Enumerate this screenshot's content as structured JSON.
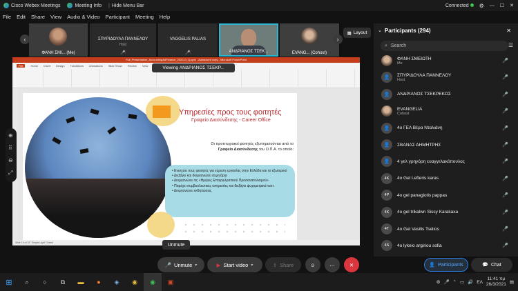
{
  "titlebar": {
    "app_title": "Cisco Webex Meetings",
    "info_tab": "Meeting Info",
    "hide_menu": "Hide Menu Bar",
    "connection": "Connected"
  },
  "menu": [
    "File",
    "Edit",
    "Share",
    "View",
    "Audio & Video",
    "Participant",
    "Meeting",
    "Help"
  ],
  "video_strip": {
    "tiles": [
      {
        "name": "ΦΑΝΗ ΣΜΙ... (Me)",
        "role": ""
      },
      {
        "name": "ΣΠΥΡΙΔΟΥΛΑ ΠΑΝΝΕΛΟΥ",
        "role": "Host"
      },
      {
        "name": "VAGGELIS PALIAS",
        "role": ""
      },
      {
        "name": "ΑΝΔΡΙΑΝΟΣ ΤΣΕΚ...",
        "role": ""
      },
      {
        "name": "EVANG... (Cohost)",
        "role": ""
      }
    ],
    "layout_label": "Layout"
  },
  "share": {
    "viewing_label": "Viewing ΑΝΔΡΙΑΝΟΣ ΤΣΕΚΡ...",
    "ppt_title": "Full_Presentation_AccountingAdFinance_2020-2 (1).pptx - Autosaved copy - Microsoft PowerPoint",
    "ppt_tabs": [
      "File",
      "Home",
      "Insert",
      "Design",
      "Transitions",
      "Animations",
      "Slide Show",
      "Review",
      "View"
    ],
    "status": "Slide 19 of 24    \"Simple Light\"    Greek",
    "slide": {
      "title": "Υπηρεσίες προς τους φοιτητές",
      "subtitle": "Γραφείο Διασύνδεσης - Career Office",
      "intro_line1": "Οι προπτυχιακοί φοιτητές εξυπηρετούνται από το",
      "intro_bold": "Γραφείο Διασύνδεσης",
      "intro_line2": "του Ο.Π.Α. το οποίο:",
      "bullets": [
        "Ενισχύει τους φοιτητές για εύρεση εργασίας στην Ελλάδα και το εξωτερικό",
        "Διεξάγει και διοργανώνει σεμινάρια",
        "Διοργανώνει τις «Ημέρες Επαγγελματικού Προσανατολισμού»",
        "Παρέχει συμβουλευτικές υπηρεσίες και διεξάγει ψυχομετρικά τεστ",
        "Διοργανώνει εκδηλώσεις"
      ]
    }
  },
  "tooltip": "Unmute",
  "controls": {
    "unmute": "Unmute",
    "start_video": "Start video",
    "share": "Share",
    "participants": "Participants",
    "chat": "Chat"
  },
  "participants_panel": {
    "header": "Participants (294)",
    "search_placeholder": "Search",
    "list": [
      {
        "name": "ΦΑΝΗ ΣΜΕΙΩΤΗ",
        "role": "Me",
        "initials": "",
        "avatar": "photo"
      },
      {
        "name": "ΣΠΥΡΙΔΟΥΛΑ ΠΑΝΝΕΛΟΥ",
        "role": "Host",
        "initials": "",
        "avatar": "person"
      },
      {
        "name": "ΑΝΔΡΙΑΝΟΣ ΤΣΕΚΡΕΚΟΣ",
        "role": "",
        "initials": "",
        "avatar": "person"
      },
      {
        "name": "EVANGELIA",
        "role": "Cohost",
        "initials": "",
        "avatar": "photo"
      },
      {
        "name": "4ο ΓΕΛ Βέρα Νταλιάνη",
        "role": "",
        "initials": "",
        "avatar": "person"
      },
      {
        "name": "ΣΒΑΝΑΣ ΔΗΜΗΤΡΗΣ",
        "role": "",
        "initials": "",
        "avatar": "person"
      },
      {
        "name": "4 γελ γρηγόρη ευαγγελακόπουλος",
        "role": "",
        "initials": "",
        "avatar": "person"
      },
      {
        "name": "4o Gel Lefteris karas",
        "role": "",
        "initials": "4K",
        "avatar": "initials"
      },
      {
        "name": "4o gel panagiotis pappas",
        "role": "",
        "initials": "4P",
        "avatar": "initials"
      },
      {
        "name": "4o gel trikalwn Sissy Karakaxa",
        "role": "",
        "initials": "4K",
        "avatar": "initials"
      },
      {
        "name": "4o Gel Vasilis Tselios",
        "role": "",
        "initials": "4T",
        "avatar": "initials"
      },
      {
        "name": "4o lykeio argiriou sofia",
        "role": "",
        "initials": "4S",
        "avatar": "initials"
      }
    ]
  },
  "taskbar": {
    "time": "11:41 πμ",
    "date": "26/3/2021",
    "lang": "ΕΛ"
  },
  "colors": {
    "accent_blue": "#2b7de0",
    "mute_red": "#d9363e",
    "connected_green": "#3ec24f",
    "slide_red": "#b5262c",
    "slide_box": "#a7dbe6"
  }
}
